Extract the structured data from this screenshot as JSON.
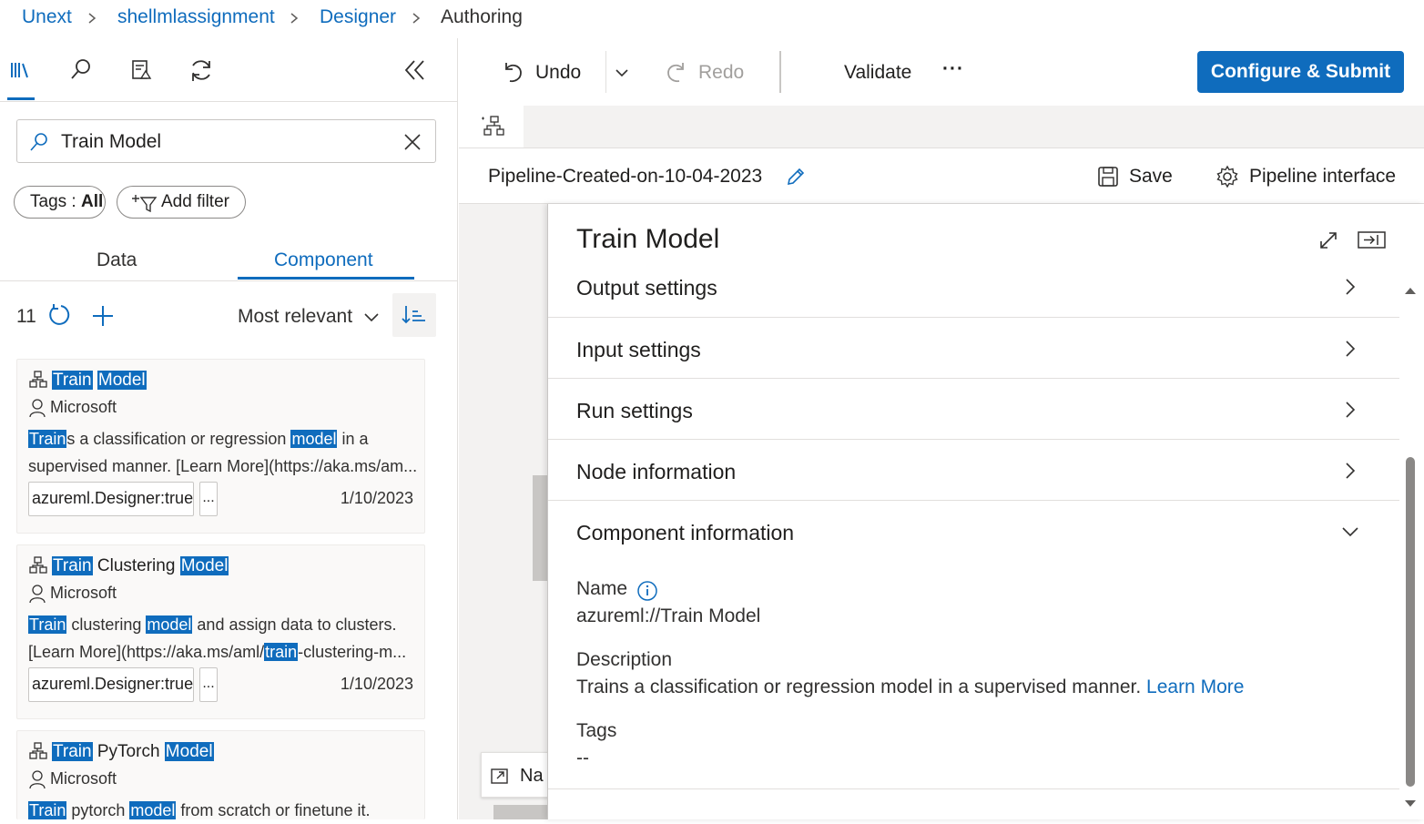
{
  "breadcrumb": {
    "items": [
      "Unext",
      "shellmlassignment",
      "Designer"
    ],
    "current": "Authoring"
  },
  "left_panel": {
    "toolbar_icons": [
      "library-icon",
      "search-icon",
      "datasets-icon",
      "refresh-icon"
    ],
    "collapse_icon": "double-chevron-left-icon",
    "search": {
      "value": "Train Model"
    },
    "filters": {
      "tags_label": "Tags :",
      "tags_value": "All",
      "add_filter_label": "Add filter"
    },
    "tabs": [
      {
        "label": "Data",
        "selected": false
      },
      {
        "label": "Component",
        "selected": true
      }
    ],
    "results": {
      "count": "11",
      "sort_label": "Most relevant"
    },
    "components": [
      {
        "title_parts": [
          {
            "text": "Train",
            "hl": true
          },
          {
            "text": " ",
            "hl": false
          },
          {
            "text": "Model",
            "hl": true
          }
        ],
        "author": "Microsoft",
        "desc_line1": [
          {
            "text": "Train",
            "hl": true
          },
          {
            "text": "s a classification or regression ",
            "hl": false
          },
          {
            "text": "model",
            "hl": true
          },
          {
            "text": " in a",
            "hl": false
          }
        ],
        "desc_line2": [
          {
            "text": "supervised manner. [Learn More](https://aka.ms/am...",
            "hl": false
          }
        ],
        "tag": "azureml.Designer:true",
        "more": "...",
        "date": "1/10/2023"
      },
      {
        "title_parts": [
          {
            "text": "Train",
            "hl": true
          },
          {
            "text": " Clustering ",
            "hl": false
          },
          {
            "text": "Model",
            "hl": true
          }
        ],
        "author": "Microsoft",
        "desc_line1": [
          {
            "text": "Train",
            "hl": true
          },
          {
            "text": " clustering ",
            "hl": false
          },
          {
            "text": "model",
            "hl": true
          },
          {
            "text": " and assign data to clusters.",
            "hl": false
          }
        ],
        "desc_line2": [
          {
            "text": "[Learn More](https://aka.ms/aml/",
            "hl": false
          },
          {
            "text": "train",
            "hl": true
          },
          {
            "text": "-clustering-m...",
            "hl": false
          }
        ],
        "tag": "azureml.Designer:true",
        "more": "...",
        "date": "1/10/2023"
      },
      {
        "title_parts": [
          {
            "text": "Train",
            "hl": true
          },
          {
            "text": " PyTorch ",
            "hl": false
          },
          {
            "text": "Model",
            "hl": true
          }
        ],
        "author": "Microsoft",
        "desc_line1": [
          {
            "text": "Train",
            "hl": true
          },
          {
            "text": " pytorch ",
            "hl": false
          },
          {
            "text": "model",
            "hl": true
          },
          {
            "text": " from scratch or finetune it.",
            "hl": false
          }
        ],
        "desc_line2": [],
        "tag": "",
        "more": "",
        "date": ""
      }
    ]
  },
  "toolbar": {
    "undo_label": "Undo",
    "redo_label": "Redo",
    "validate_label": "Validate",
    "more_label": "···",
    "submit_label": "Configure & Submit"
  },
  "canvas": {
    "pipeline_name": "Pipeline-Created-on-10-04-2023",
    "save_label": "Save",
    "interface_label": "Pipeline interface",
    "navigator_label": "Na"
  },
  "detail_panel": {
    "title": "Train Model",
    "sections": [
      {
        "label": "Output settings",
        "expanded": false
      },
      {
        "label": "Input settings",
        "expanded": false
      },
      {
        "label": "Run settings",
        "expanded": false
      },
      {
        "label": "Node information",
        "expanded": false
      },
      {
        "label": "Component information",
        "expanded": true
      }
    ],
    "component_info": {
      "name_label": "Name",
      "name_value": "azureml://Train Model",
      "description_label": "Description",
      "description_value": "Trains a classification or regression model in a supervised manner.",
      "learn_more": "Learn More",
      "tags_label": "Tags",
      "tags_value": "--"
    }
  },
  "colors": {
    "accent": "#0f6cbd",
    "highlight_bg": "#0f6cbd",
    "panel_bg": "#f3f2f1"
  }
}
